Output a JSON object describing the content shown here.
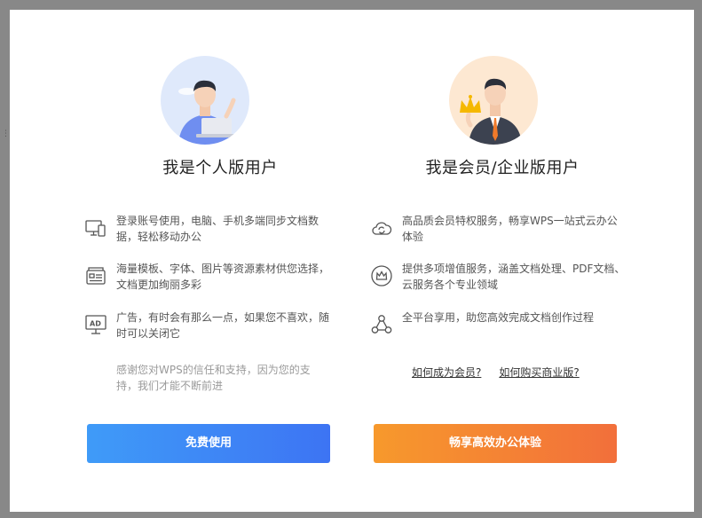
{
  "personal": {
    "title": "我是个人版用户",
    "features": [
      {
        "icon": "devices-sync-icon",
        "text": "登录账号使用，电脑、手机多端同步文档数据，轻松移动办公"
      },
      {
        "icon": "template-library-icon",
        "text": "海量模板、字体、图片等资源素材供您选择，文档更加绚丽多彩"
      },
      {
        "icon": "ad-icon",
        "text": "广告，有时会有那么一点，如果您不喜欢，随时可以关闭它"
      }
    ],
    "thanks": "感谢您对WPS的信任和支持，因为您的支持，我们才能不断前进",
    "button": "免费使用"
  },
  "enterprise": {
    "title": "我是会员/企业版用户",
    "features": [
      {
        "icon": "cloud-service-icon",
        "text": "高品质会员特权服务，畅享WPS一站式云办公体验"
      },
      {
        "icon": "crown-badge-icon",
        "text": "提供多项增值服务，涵盖文档处理、PDF文档、云服务各个专业领域"
      },
      {
        "icon": "network-nodes-icon",
        "text": "全平台享用，助您高效完成文档创作过程"
      }
    ],
    "links": {
      "become_member": "如何成为会员?",
      "buy_business": "如何购买商业版?"
    },
    "button": "畅享高效办公体验"
  },
  "colors": {
    "free_button": [
      "#3f9bf8",
      "#3d74f3"
    ],
    "pro_button": [
      "#f7992c",
      "#f26f3b"
    ]
  }
}
